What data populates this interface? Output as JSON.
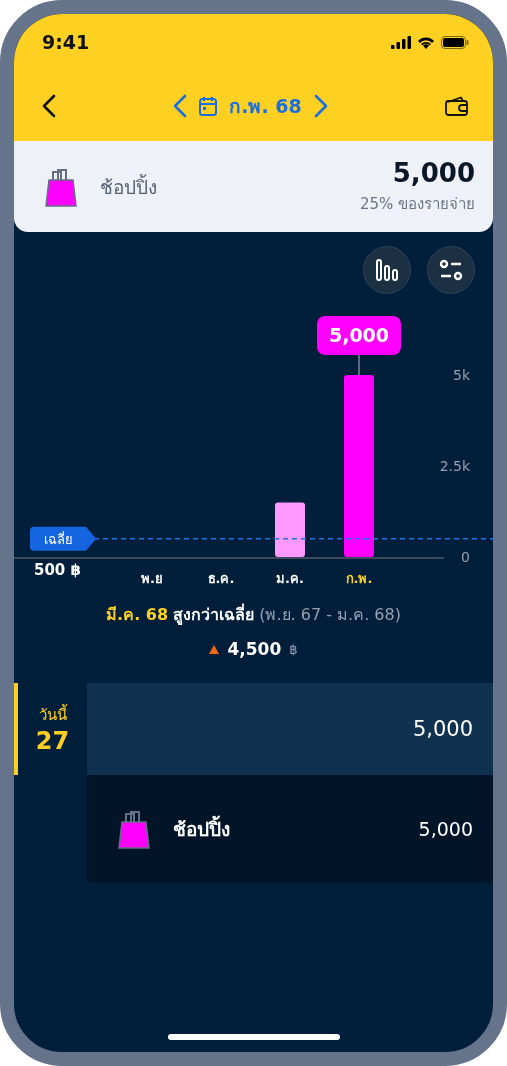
{
  "status_bar": {
    "time": "9:41"
  },
  "nav": {
    "period": "ก.พ. 68"
  },
  "summary": {
    "category": "ช้อปปิ้ง",
    "amount": "5,000",
    "share": "25% ของรายจ่าย"
  },
  "chart": {
    "chart_data": {
      "type": "bar",
      "categories": [
        "พ.ย",
        "ธ.ค.",
        "ม.ค.",
        "ก.พ."
      ],
      "series": [
        {
          "color": "#ff99ff",
          "values": [
            0,
            0,
            1500,
            null
          ]
        },
        {
          "color": "#ff00ff",
          "values": [
            null,
            null,
            null,
            5000
          ]
        }
      ],
      "stacked": true,
      "ylim": [
        0,
        5000
      ],
      "yticks": [
        0,
        {
          "value": 2500,
          "label": "2.5k"
        },
        {
          "value": 5000,
          "label": "5k"
        }
      ],
      "ref_lines": [
        {
          "axis": "y",
          "value": 500,
          "label": "500 ฿",
          "color": "#1f72e8"
        }
      ]
    },
    "bars": [
      {
        "selected": false
      },
      {
        "selected": false
      },
      {
        "selected": false
      },
      {
        "selected": true
      }
    ],
    "average_tag": "เฉลี่ย",
    "tooltip": "5,000"
  },
  "comparison": {
    "period": "มี.ค. 68",
    "label": "สูงกว่าเฉลี่ย",
    "range": "(พ.ย. 67 - ม.ค. 68)",
    "increase": true,
    "amount": "4,500",
    "currency": "฿"
  },
  "days": [
    {
      "label": "วันนี้",
      "day": "27",
      "total": "5,000",
      "today": true,
      "items": [
        {
          "category": "ช้อปปิ้ง",
          "amount": "5,000"
        }
      ]
    }
  ]
}
